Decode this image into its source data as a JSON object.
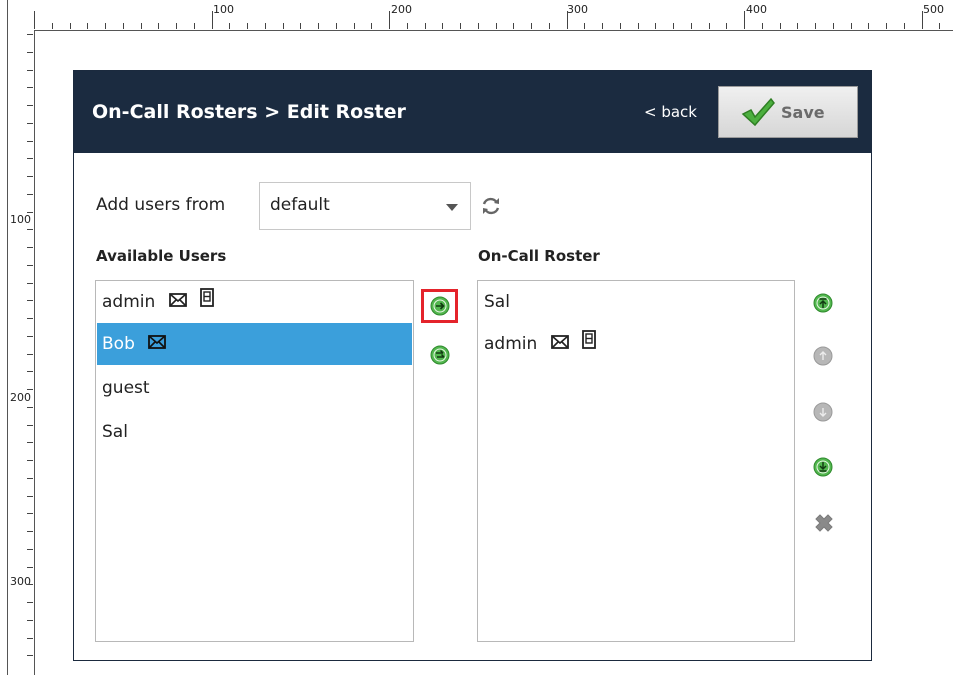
{
  "ruler": {
    "top_labels": [
      "100",
      "200",
      "300",
      "400",
      "500"
    ],
    "left_labels": [
      "100",
      "200",
      "300"
    ]
  },
  "header": {
    "title": "On-Call Rosters > Edit Roster",
    "back_label": "< back",
    "save_label": "Save"
  },
  "source": {
    "label": "Add users from",
    "selected": "default"
  },
  "available": {
    "heading": "Available Users",
    "items": [
      {
        "name": "admin",
        "icons": [
          "email-icon",
          "phone-icon"
        ],
        "selected": false
      },
      {
        "name": "Bob",
        "icons": [
          "email-icon"
        ],
        "selected": true
      },
      {
        "name": "guest",
        "icons": [],
        "selected": false
      },
      {
        "name": "Sal",
        "icons": [],
        "selected": false
      }
    ]
  },
  "roster": {
    "heading": "On-Call Roster",
    "items": [
      {
        "name": "Sal",
        "icons": []
      },
      {
        "name": "admin",
        "icons": [
          "email-icon",
          "phone-icon"
        ]
      }
    ]
  },
  "colors": {
    "header_bg": "#1b2b40",
    "selected_row": "#3b9fdb",
    "button_green": "#3fae49",
    "highlight_red": "#e4232b",
    "disabled_gray": "#b5b5b5"
  }
}
